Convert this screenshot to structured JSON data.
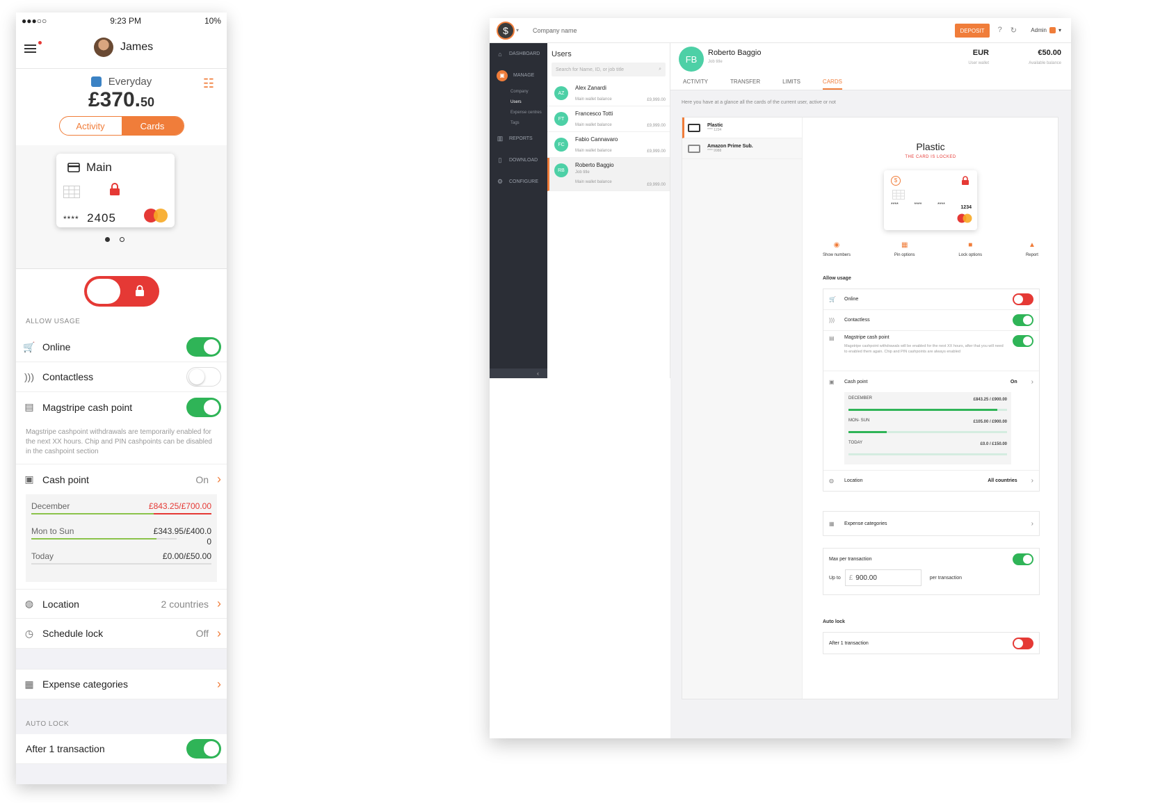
{
  "mobile": {
    "status": {
      "carrier": "●●●○○",
      "time": "9:23 PM",
      "battery": "10%"
    },
    "user_name": "James",
    "account": {
      "name": "Everyday",
      "amount_major": "£370.",
      "amount_minor": "50"
    },
    "segments": [
      "Activity",
      "Cards"
    ],
    "card": {
      "name": "Main",
      "masked": "****",
      "last4": "2405"
    },
    "allow_usage_label": "ALLOW USAGE",
    "rows": {
      "online": "Online",
      "contactless": "Contactless",
      "magstripe": "Magstripe cash point"
    },
    "magstripe_note": "Magstripe cashpoint withdrawals are temporarily enabled for the next XX hours. Chip and PIN cashpoints can be disabled in the cashpoint section",
    "cashpoint": {
      "label": "Cash point",
      "value": "On"
    },
    "limits": [
      {
        "label": "December",
        "value": "£843.25/£700.00",
        "progress": 1.0,
        "over": true
      },
      {
        "label": "Mon to Sun",
        "value": "£343.95/£400.0",
        "progress": 0.86,
        "extra": "0"
      },
      {
        "label": "Today",
        "value": "£0.00/£50.00",
        "progress": 0.0
      }
    ],
    "location": {
      "label": "Location",
      "value": "2 countries"
    },
    "schedule": {
      "label": "Schedule lock",
      "value": "Off"
    },
    "expense": "Expense categories",
    "auto_lock_label": "AUTO LOCK",
    "after_tx": "After 1 transaction",
    "colors": {
      "accent": "#f07d3a",
      "green": "#2fb457",
      "red": "#e53935"
    }
  },
  "desktop": {
    "company": "Company name",
    "deposit": "DEPOSIT",
    "admin": "Admin",
    "nav": [
      "DASHBOARD",
      "MANAGE",
      "REPORTS",
      "DOWNLOAD",
      "CONFIGURE"
    ],
    "subnav": [
      "Company",
      "Users",
      "Expense centres",
      "Tags"
    ],
    "users_title": "Users",
    "search_placeholder": "Search for Name, ID, or job title",
    "users": [
      {
        "initials": "AZ",
        "name": "Alex Zanardi",
        "sub": "Main wallet balance",
        "balance": "£9,999.00"
      },
      {
        "initials": "FT",
        "name": "Francesco Totti",
        "sub": "Main wallet balance",
        "balance": "£9,999.00"
      },
      {
        "initials": "FC",
        "name": "Fabio Cannavaro",
        "sub": "Main wallet balance",
        "balance": "£9,999.00"
      },
      {
        "initials": "RB",
        "name": "Roberto Baggio",
        "job": "Job title",
        "sub": "Main wallet balance",
        "balance": "£9,999.00"
      }
    ],
    "profile": {
      "initials": "FB",
      "name": "Roberto Baggio",
      "job": "Job title",
      "currency": "EUR",
      "currency_sub": "User wallet",
      "balance": "€50.00",
      "balance_sub": "Available balance"
    },
    "tabs": [
      "ACTIVITY",
      "TRANSFER",
      "LIMITS",
      "CARDS"
    ],
    "intro": "Here you have at a glance all the cards of the current user, active or not",
    "cards": [
      {
        "name": "Plastic",
        "num": "**** 1234"
      },
      {
        "name": "Amazon Prime Sub.",
        "num": "**** 9988"
      }
    ],
    "card_title": "Plastic",
    "card_locked": "THE CARD IS LOCKED",
    "mini_card": {
      "groups": [
        "****",
        "****",
        "****",
        "1234"
      ]
    },
    "actions": [
      "Show numbers",
      "Pin options",
      "Lock options",
      "Report"
    ],
    "allow_usage": "Allow usage",
    "online": "Online",
    "contactless": "Contactless",
    "magstripe": "Magstripe cash point",
    "magstripe_note": "Magstripe cashpoint withdrawals will be enabled for the next XX hours, after that you will need to enabled them again. Chip and PIN cashpoints are always enabled",
    "cashpoint": {
      "label": "Cash point",
      "value": "On"
    },
    "limits": [
      {
        "label": "DECEMBER",
        "value": "£843.25 / £900.00",
        "progress": 0.94
      },
      {
        "label": "MON- SUN",
        "value": "£105.00 / £900.00",
        "progress": 0.24
      },
      {
        "label": "TODAY",
        "value": "£0.0 / £150.00",
        "progress": 0.0
      }
    ],
    "location": {
      "label": "Location",
      "value": "All countries"
    },
    "expense": "Expense categories",
    "max_tx": "Max per transaction",
    "up_to": "Up to",
    "amount_currency": "£",
    "amount": "900.00",
    "per_tx": "per transaction",
    "auto_lock": "Auto lock",
    "after_tx": "After 1 transaction"
  }
}
